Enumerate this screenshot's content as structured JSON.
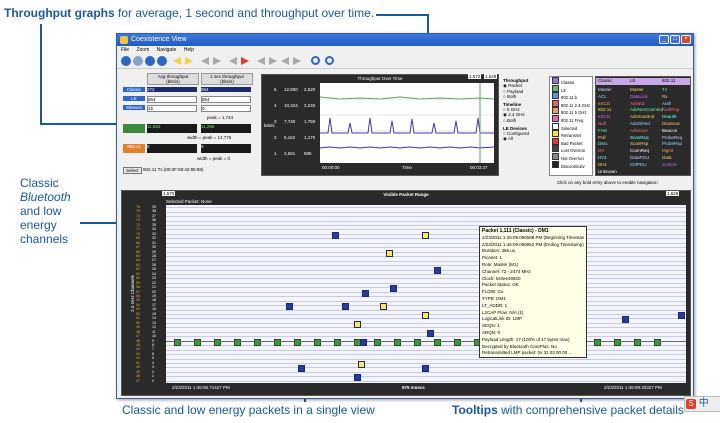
{
  "callouts": {
    "throughput_bold": "Throughput graphs",
    "throughput_rest": " for average, 1 second and throughput over time.",
    "classic_1": "Classic",
    "classic_2": "Bluetooth",
    "classic_3": "and low",
    "classic_4": "energy",
    "classic_5": "channels",
    "packets": "Classic and low energy packets in a single view",
    "tooltips_bold": "Tooltips",
    "tooltips_rest": " with comprehensive packet details"
  },
  "window": {
    "title": "Coexistence View",
    "menu": [
      "File",
      "Zoom",
      "Navigate",
      "Help"
    ]
  },
  "throughput_panel": {
    "col1": "Avg throughput",
    "col1b": "(bits/s)",
    "col2": "1 sec throughput",
    "col2b": "(bits/s)",
    "rows": [
      {
        "label": "Classic",
        "v1": "272",
        "v2": "864"
      },
      {
        "label": "LE",
        "v1": "864",
        "v2": "864"
      },
      {
        "label": "Sleeves",
        "v1": "15",
        "v2": "0"
      }
    ],
    "peak1": "peak = 1,744",
    "le_v1": "11,683",
    "le_v2": "11,296",
    "peak2": "width = peak = 12,776",
    "bd_label": "802.11",
    "bd_v1": "0",
    "bd_v2": "0",
    "peak3": "width = peak = 0",
    "select_btn": "Select",
    "select_text": "802.11 Tx  (00:2F:58:42:86:88)"
  },
  "graph": {
    "title": "Throughput Over Time",
    "badge_l": "1,572",
    "badge_r": "1,528",
    "y_title": "bits/s",
    "y_ticks": [
      "6",
      "4",
      "3",
      "2",
      "1"
    ],
    "y_left_vals": [
      "12,800",
      "10,324",
      "7,740",
      "5,162",
      "2,581"
    ],
    "y_right_vals": [
      "2,520",
      "2,240",
      "1,750",
      "1,170",
      "585"
    ],
    "x_left": "00:00:00",
    "x_mid": "Time",
    "x_right": "00:03:37"
  },
  "options": {
    "throughput_title": "Throughput",
    "throughput_opts": [
      "Packet",
      "Payload",
      "Both"
    ],
    "timeline_title": "Timeline",
    "timeline_opts": [
      "5 GHz",
      "2.4 GHz",
      "Both"
    ],
    "le_title": "LE Devices",
    "le_opts": [
      "Configured",
      "All"
    ]
  },
  "legend": {
    "items": [
      "Classic",
      "LE",
      "802.11 b",
      "802.11 2.4 GHz",
      "802.11 5 GHz",
      "802.11 Freq",
      "Selected",
      "Retransmit",
      "Bad Packet",
      "Lost Overrun",
      "Not Overrun",
      "Discontinuity"
    ],
    "colors": [
      "#9c6fdb",
      "#6fb36f",
      "#6a8ed8",
      "#d86a6a",
      "#d8a86a",
      "#d86ab8",
      "#ffffff",
      "#f2e23a",
      "#e23a3a",
      "#444444",
      "#888888",
      "#222222"
    ]
  },
  "le_table": {
    "head": [
      "Classic",
      "LE",
      "802.11"
    ],
    "rows": [
      [
        "Master",
        "Master",
        "Tx"
      ],
      [
        "ACL",
        "DataLink",
        "Rx"
      ],
      [
        "eSCO",
        "AdvInd",
        "Auth"
      ],
      [
        "802.11",
        "AdvNonConnInd",
        "AuthRsp"
      ],
      [
        "eSCO",
        "AdvScanInd",
        "Deauth"
      ],
      [
        "Null",
        "AdvDirInd",
        "Disassoc"
      ],
      [
        "FHS",
        "AdvScan",
        "Beacon"
      ],
      [
        "Poll",
        "ScanReq",
        "ProbeReq"
      ],
      [
        "DM1",
        "ScanRsp",
        "ProbeRsp"
      ],
      [
        "DV",
        "ConnReq",
        "Mgmt"
      ],
      [
        "HV1",
        "DataPDU",
        "Data"
      ],
      [
        "DH1",
        "CtrlPDU",
        "Control"
      ],
      [
        "Unknown",
        "",
        ""
      ]
    ],
    "hint": "Click on any bold entry above to enable navigation"
  },
  "packet_range": {
    "title": "Visible Packet Range",
    "badge_l": "1,570",
    "badge_r": "1,626",
    "selected": "Selected Packet: None",
    "axis_label": "2.4 GHz Channels",
    "bottom_left": "2/23/2011 1:45:06.71427 PM",
    "bottom_mid": "675 msecs",
    "bottom_right": "2/23/2011 1:45:09.33327 PM",
    "y_labels": [
      "39",
      "38",
      "37",
      "36",
      "35",
      "34",
      "33",
      "32",
      "31",
      "30",
      "29",
      "28",
      "27",
      "26",
      "25",
      "24",
      "23",
      "22",
      "21",
      "20",
      "19",
      "18",
      "17",
      "16",
      "15",
      "14",
      "13",
      "12",
      "11",
      "10",
      "9",
      "8",
      "7",
      "6",
      "5",
      "4",
      "3",
      "2",
      "1",
      "0"
    ],
    "classic_vals": [
      "76",
      "75",
      "74",
      "73",
      "72",
      "71",
      "70",
      "69",
      "68",
      "67",
      "66",
      "65",
      "64",
      "63",
      "62",
      "61",
      "60",
      "59",
      "58",
      "57",
      "56",
      "55",
      "54",
      "53",
      "52",
      "51",
      "50",
      "49",
      "48",
      "47",
      "46",
      "45",
      "44",
      "43",
      "42",
      "41",
      "40",
      "39",
      "38",
      "37"
    ]
  },
  "tooltip": {
    "title": "Packet 1,111 (Classic) - DM1",
    "lines": [
      "2/23/2011 1:45:09.096588 PM (Beginning Timestamp)",
      "2/23/2011 1:45:09.096952 PM (Ending Timestamp)",
      "Duration: 366 us",
      "Piconet: 1",
      "Role: Master (M1)",
      "Channel: 72 - 2474 MHz",
      "Clock: 0x0ee48600",
      "Packet Status: OK",
      "FLOW: Go",
      "TYPE: DM1",
      "LT_ADDR: 1",
      "L2CAP Flow: N/A (1)",
      "LogicalLink ID: LMP",
      "SEQN: 1",
      "ARQN: 0",
      "Payload Length: 17 (100% of 17 bytes max)",
      "Decrypted by Bluetooth CorePlus: No",
      "Retransmitted LMP packet: 0x 32 03 00 00 ..."
    ]
  },
  "ime": {
    "label": "中"
  }
}
